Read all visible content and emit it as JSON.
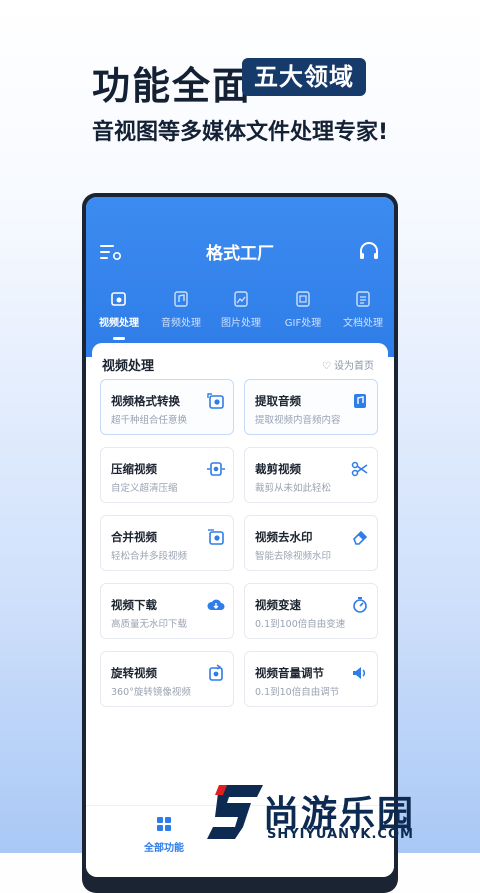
{
  "hero": {
    "title": "功能全面",
    "tag": "五大领域",
    "subtitle": "音视图等多媒体文件处理专家!"
  },
  "app": {
    "title": "格式工厂",
    "icons": {
      "menu": "menu-settings-icon",
      "support": "headset-icon"
    }
  },
  "tabs": [
    {
      "label": "视频处理",
      "icon": "video-icon",
      "active": true
    },
    {
      "label": "音频处理",
      "icon": "audio-file-icon",
      "active": false
    },
    {
      "label": "图片处理",
      "icon": "image-file-icon",
      "active": false
    },
    {
      "label": "GIF处理",
      "icon": "gif-file-icon",
      "active": false
    },
    {
      "label": "文档处理",
      "icon": "document-file-icon",
      "active": false
    }
  ],
  "section": {
    "title": "视频处理",
    "set_home": "设为首页"
  },
  "cards": [
    {
      "title": "视频格式转换",
      "desc": "超千种组合任意换",
      "icon": "video-convert-icon"
    },
    {
      "title": "提取音频",
      "desc": "提取视频内音频内容",
      "icon": "extract-audio-icon"
    },
    {
      "title": "压缩视频",
      "desc": "自定义超清压缩",
      "icon": "compress-icon"
    },
    {
      "title": "裁剪视频",
      "desc": "裁剪从未如此轻松",
      "icon": "scissors-icon"
    },
    {
      "title": "合并视频",
      "desc": "轻松合并多段视频",
      "icon": "merge-icon"
    },
    {
      "title": "视频去水印",
      "desc": "智能去除视频水印",
      "icon": "eraser-icon"
    },
    {
      "title": "视频下载",
      "desc": "高质量无水印下载",
      "icon": "cloud-download-icon"
    },
    {
      "title": "视频变速",
      "desc": "0.1到100倍自由变速",
      "icon": "speed-icon"
    },
    {
      "title": "旋转视频",
      "desc": "360°旋转镜像视频",
      "icon": "rotate-icon"
    },
    {
      "title": "视频音量调节",
      "desc": "0.1到10倍自由调节",
      "icon": "volume-icon"
    }
  ],
  "bottom_nav": {
    "label": "全部功能",
    "icon": "grid-icon"
  },
  "watermark": {
    "cn": "尚游乐园",
    "en": "SHYIYUANYK.COM"
  },
  "colors": {
    "accent": "#2f7de8",
    "dark": "#163a6a"
  }
}
